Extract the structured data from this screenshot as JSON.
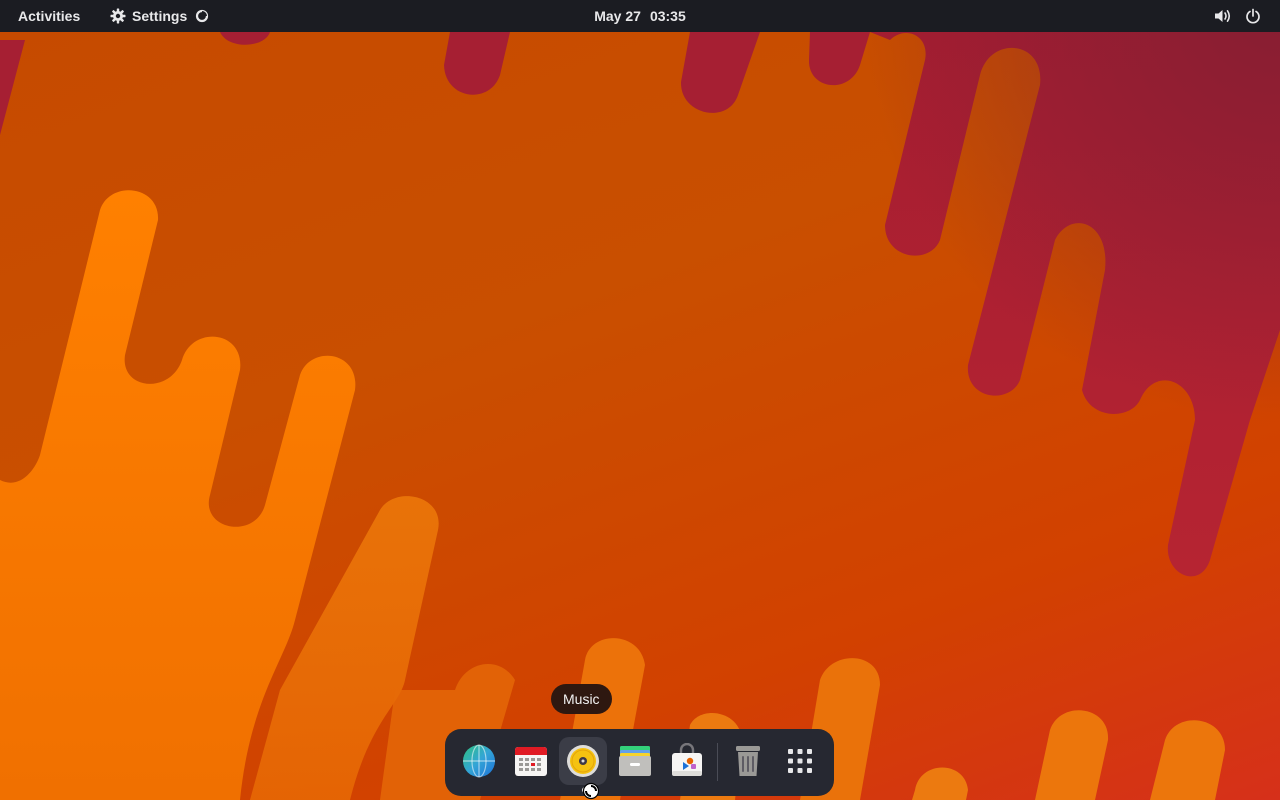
{
  "topbar": {
    "activities_label": "Activities",
    "app_menu": {
      "label": "Settings",
      "icon": "gear-icon",
      "status_icon": "loading-spinner-icon"
    },
    "clock": {
      "date": "May 27",
      "time": "03:35"
    },
    "status_icons": [
      "volume-icon",
      "power-icon"
    ]
  },
  "dock": {
    "items": [
      {
        "name": "web-browser",
        "icon": "globe-icon"
      },
      {
        "name": "calendar",
        "icon": "calendar-icon"
      },
      {
        "name": "music",
        "icon": "music-disc-icon",
        "active": true,
        "running": true
      },
      {
        "name": "files",
        "icon": "file-cabinet-icon"
      },
      {
        "name": "software",
        "icon": "shopping-bag-icon"
      },
      {
        "name": "trash",
        "icon": "trash-icon"
      },
      {
        "name": "show-applications",
        "icon": "app-grid-icon"
      }
    ]
  },
  "tooltip": {
    "text": "Music"
  },
  "colors": {
    "topbar_bg": "#1b1c22",
    "dock_bg": "#262831",
    "wallpaper_orange": "#c94f00",
    "wallpaper_light": "#ff7f00",
    "wallpaper_crimson": "#a81e33"
  }
}
